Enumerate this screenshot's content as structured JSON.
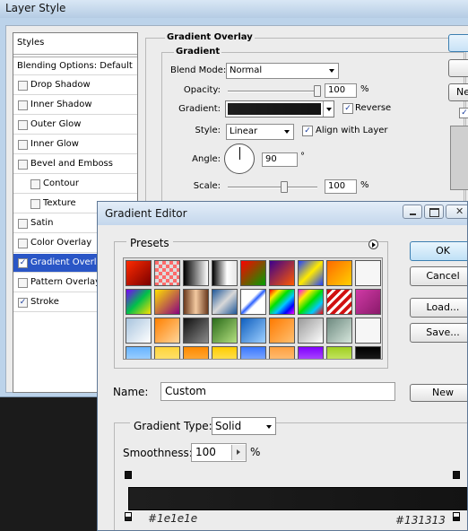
{
  "layer_style": {
    "title": "Layer Style",
    "styles_header": "Styles",
    "items": [
      {
        "label": "Blending Options: Default",
        "checkbox": false,
        "checked": false
      },
      {
        "label": "Drop Shadow",
        "checkbox": true,
        "checked": false
      },
      {
        "label": "Inner Shadow",
        "checkbox": true,
        "checked": false
      },
      {
        "label": "Outer Glow",
        "checkbox": true,
        "checked": false
      },
      {
        "label": "Inner Glow",
        "checkbox": true,
        "checked": false
      },
      {
        "label": "Bevel and Emboss",
        "checkbox": true,
        "checked": false
      },
      {
        "label": "Contour",
        "checkbox": true,
        "checked": false
      },
      {
        "label": "Texture",
        "checkbox": true,
        "checked": false
      },
      {
        "label": "Satin",
        "checkbox": true,
        "checked": false
      },
      {
        "label": "Color Overlay",
        "checkbox": true,
        "checked": false
      },
      {
        "label": "Gradient Overlay",
        "checkbox": true,
        "checked": true,
        "selected": true
      },
      {
        "label": "Pattern Overlay",
        "checkbox": true,
        "checked": false
      },
      {
        "label": "Stroke",
        "checkbox": true,
        "checked": true
      }
    ],
    "gradient_overlay": {
      "section_title": "Gradient Overlay",
      "group_title": "Gradient",
      "blend_mode_label": "Blend Mode:",
      "blend_mode_value": "Normal",
      "opacity_label": "Opacity:",
      "opacity_value": "100",
      "opacity_level": 1.0,
      "percent": "%",
      "gradient_label": "Gradient:",
      "reverse_label": "Reverse",
      "reverse_checked": true,
      "style_label": "Style:",
      "style_value": "Linear",
      "align_label": "Align with Layer",
      "align_checked": true,
      "angle_label": "Angle:",
      "angle_value": "90",
      "degree": "°",
      "scale_label": "Scale:",
      "scale_value": "100",
      "scale_level": 0.63
    },
    "right_buttons": [
      "Ne"
    ]
  },
  "gradient_editor": {
    "title": "Gradient Editor",
    "presets_label": "Presets",
    "ok_label": "OK",
    "cancel_label": "Cancel",
    "load_label": "Load...",
    "save_label": "Save...",
    "name_label": "Name:",
    "name_value": "Custom",
    "new_label": "New",
    "gradient_type_label": "Gradient Type:",
    "gradient_type_value": "Solid",
    "smoothness_label": "Smoothness:",
    "smoothness_value": "100",
    "smoothness_unit": "%",
    "stop_left_color": "#1e1e1e",
    "stop_right_color": "#131313",
    "stop_left_label": "#1e1e1e",
    "stop_right_label": "#131313",
    "preset_swatches": [
      [
        "linear-gradient(135deg,#ff2a00,#7a0000)",
        "repeating-conic-gradient(#ddd 0 25%,#ff6a6a 0 50%) 0 0/8px 8px",
        "linear-gradient(90deg,#000,#fff)",
        "linear-gradient(90deg,#000,#fff 60%,#e6e6e6)",
        "linear-gradient(135deg,#ff0000,#00a000)",
        "linear-gradient(135deg,#3c008c,#ff5a00)",
        "linear-gradient(135deg,#2040ff,#ffea00,#2040ff)",
        "linear-gradient(135deg,#ff6a00,#ffd000)",
        "linear-gradient(135deg,#f6f6f6,#f6f6f6)"
      ],
      [
        "linear-gradient(135deg,#7a00ff,#00c04a,#ffe000)",
        "linear-gradient(135deg,#ffe000,#8b0080)",
        "linear-gradient(90deg,#6b3a1e,#f3c9a0,#6b3a1e)",
        "linear-gradient(135deg,#1e5799,#d8d8d8,#1e5799)",
        "linear-gradient(135deg,#ffffff 40%,#2a60ff 50%,#ffffff 60%)",
        "linear-gradient(135deg,#ff0000,#ffea00,#00e000,#00c8ff,#0000ff,#ff00ff)",
        "linear-gradient(135deg,#ff00ff,#ffea00,#00e000,#00c8ff,#ff0000)",
        "repeating-linear-gradient(135deg,#d01010 0 4px,#fff 4px 7px)",
        "linear-gradient(135deg,#d03aa6,#8a1a6a)"
      ],
      [
        "linear-gradient(135deg,#a8c4de,#ffffff)",
        "linear-gradient(135deg,#ff8000,#ffd59a)",
        "linear-gradient(135deg,#101010,#8a8a8a)",
        "linear-gradient(135deg,#2a6b1a,#b4e080)",
        "linear-gradient(135deg,#0f5fbf,#9ed0ff)",
        "linear-gradient(135deg,#ff7a00,#ffc070)",
        "linear-gradient(135deg,#9a9a9a,#ffffff)",
        "linear-gradient(135deg,#6e8a80,#d6e6dc)",
        "linear-gradient(135deg,#f6f6f6,#f6f6f6)"
      ],
      [
        "linear-gradient(180deg,#66b4ff,#cfe6ff)",
        "linear-gradient(180deg,#ffd43a,#ffea9a)",
        "linear-gradient(180deg,#ff8a00,#ffc266)",
        "linear-gradient(180deg,#ffcc00,#fff199)",
        "linear-gradient(180deg,#3a78ff,#bcd4ff)",
        "linear-gradient(180deg,#ffa040,#ffd6a0)",
        "linear-gradient(180deg,#8000ff,#d08aff)",
        "linear-gradient(180deg,#a0d020,#e6f6a0)",
        "linear-gradient(180deg,#000,#333)"
      ]
    ]
  }
}
